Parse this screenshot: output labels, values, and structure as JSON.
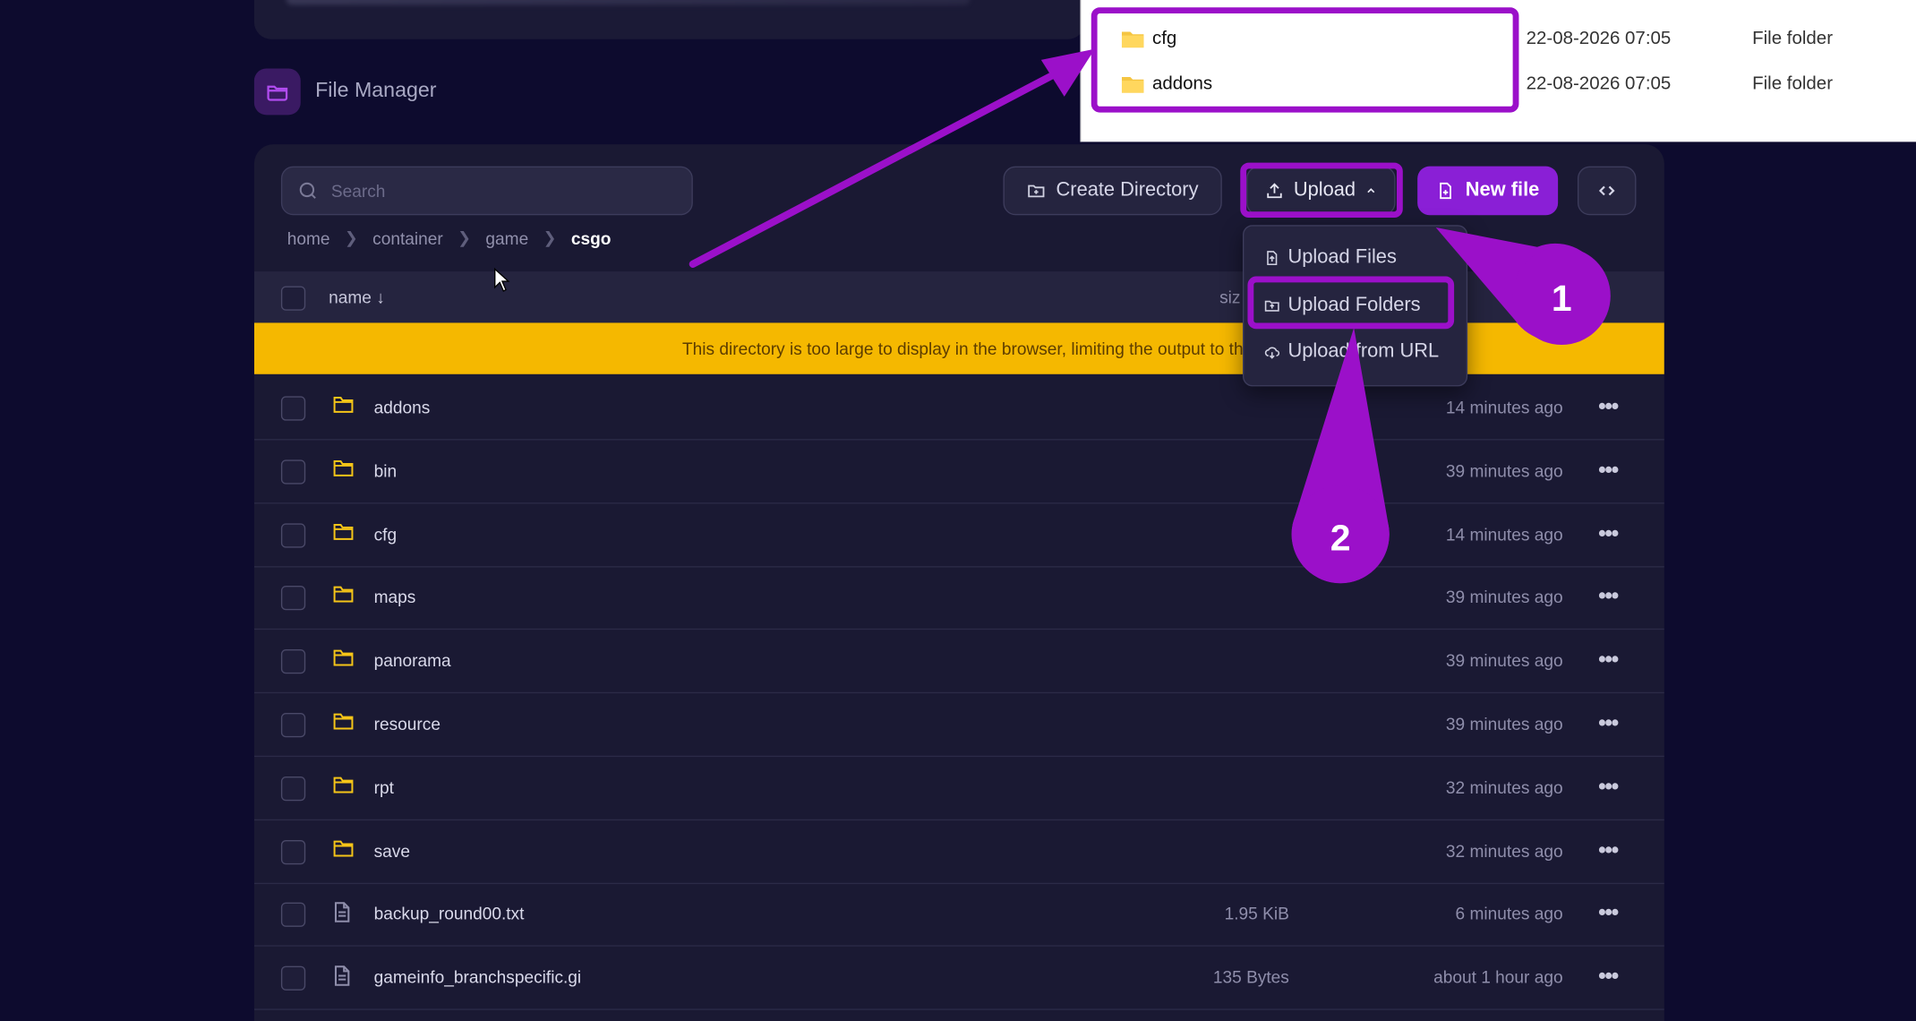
{
  "header": {
    "title": "File Manager"
  },
  "toolbar": {
    "search_placeholder": "Search",
    "create_directory": "Create Directory",
    "upload": "Upload",
    "new_file": "New file"
  },
  "breadcrumb": [
    "home",
    "container",
    "game",
    "csgo"
  ],
  "table": {
    "name_header": "name ↓",
    "size_header": "siz"
  },
  "warning": "This directory is too large to display in the browser, limiting the output to the first",
  "upload_menu": [
    "Upload Files",
    "Upload Folders",
    "Upload from URL"
  ],
  "files": [
    {
      "name": "addons",
      "type": "folder",
      "size": "",
      "modified": "14 minutes ago"
    },
    {
      "name": "bin",
      "type": "folder",
      "size": "",
      "modified": "39 minutes ago"
    },
    {
      "name": "cfg",
      "type": "folder",
      "size": "",
      "modified": "14 minutes ago"
    },
    {
      "name": "maps",
      "type": "folder",
      "size": "",
      "modified": "39 minutes ago"
    },
    {
      "name": "panorama",
      "type": "folder",
      "size": "",
      "modified": "39 minutes ago"
    },
    {
      "name": "resource",
      "type": "folder",
      "size": "",
      "modified": "39 minutes ago"
    },
    {
      "name": "rpt",
      "type": "folder",
      "size": "",
      "modified": "32 minutes ago"
    },
    {
      "name": "save",
      "type": "folder",
      "size": "",
      "modified": "32 minutes ago"
    },
    {
      "name": "backup_round00.txt",
      "type": "file",
      "size": "1.95 KiB",
      "modified": "6 minutes ago"
    },
    {
      "name": "gameinfo_branchspecific.gi",
      "type": "file",
      "size": "135 Bytes",
      "modified": "about 1 hour ago"
    }
  ],
  "explorer": [
    {
      "name": "cfg",
      "date": "22-08-2026 07:05",
      "type": "File folder"
    },
    {
      "name": "addons",
      "date": "22-08-2026 07:05",
      "type": "File folder"
    }
  ],
  "annotations": {
    "step1": "1",
    "step2": "2"
  },
  "colors": {
    "accent": "#8a1fd6",
    "highlight": "#9b10c9",
    "warning": "#f5b800",
    "background": "#0d0b2e",
    "folder": "#f5c518"
  }
}
